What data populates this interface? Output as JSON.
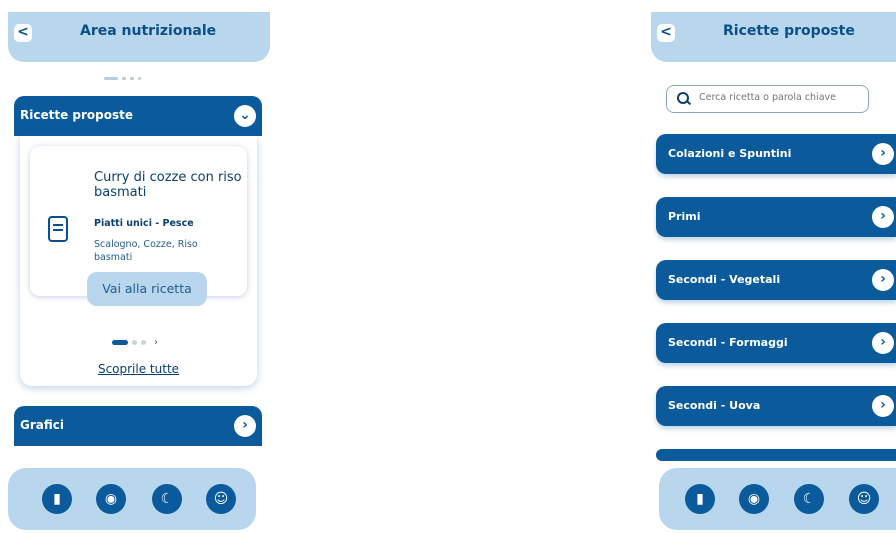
{
  "left": {
    "header": {
      "back_label": "<",
      "title": "Area nutrizionale"
    },
    "ricette_section": {
      "title": "Ricette proposte",
      "toggle_label": "⌄"
    },
    "recipe_card": {
      "title": "Curry di cozze con riso basmati",
      "category": "Piatti unici - Pesce",
      "ingredients": "Scalogno, Cozze, Riso basmati",
      "button_label": "Vai alla ricetta"
    },
    "carousel": {
      "next_label": "›"
    },
    "see_all_label": "Scoprile tutte",
    "grafici_section": {
      "title": "Grafici",
      "chevron_label": "›"
    }
  },
  "right": {
    "header": {
      "back_label": "<",
      "title": "Ricette proposte"
    },
    "search": {
      "placeholder": "Cerca ricetta o parola chiave"
    },
    "categories": [
      {
        "label": "Colazioni e Spuntini"
      },
      {
        "label": "Primi"
      },
      {
        "label": "Secondi - Vegetali"
      },
      {
        "label": "Secondi - Formaggi"
      },
      {
        "label": "Secondi - Uova"
      }
    ],
    "chevron_label": "›"
  },
  "bottom_nav": {
    "icons": [
      "door-icon",
      "target-icon",
      "moon-icon",
      "face-icon"
    ],
    "glyphs": [
      "▮",
      "◉",
      "☾",
      "☺"
    ]
  },
  "colors": {
    "primary": "#0a5a9c",
    "light": "#b8d6ec",
    "text": "#0a3f6e"
  }
}
